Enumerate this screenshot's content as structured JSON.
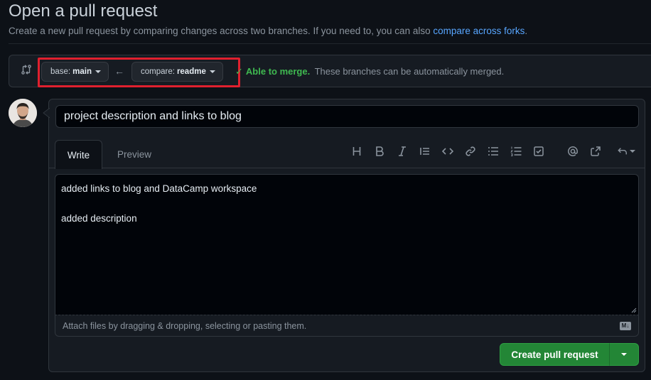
{
  "header": {
    "title": "Open a pull request",
    "subtitle": "Create a new pull request by comparing changes across two branches. If you need to, you can also ",
    "subtitle_link": "compare across forks",
    "subtitle_end": "."
  },
  "compare": {
    "base_label": "base:",
    "base_value": "main",
    "compare_label": "compare:",
    "compare_value": "readme",
    "merge_ok": "Able to merge.",
    "merge_text": "These branches can be automatically merged.",
    "highlight_color": "#e0202e"
  },
  "form": {
    "title_value": "project description and links to blog",
    "tabs": [
      {
        "label": "Write",
        "active": true
      },
      {
        "label": "Preview",
        "active": false
      }
    ],
    "toolbar_icons": [
      "heading-icon",
      "bold-icon",
      "italic-icon",
      "quote-icon",
      "code-icon",
      "link-icon",
      "bulleted-list-icon",
      "numbered-list-icon",
      "task-list-icon",
      "mention-icon",
      "cross-reference-icon",
      "reply-icon"
    ],
    "body_value": "added links to blog and DataCamp workspace\n\nadded description",
    "attach_text": "Attach files by dragging & dropping, selecting or pasting them.",
    "markdown_badge": "M↓",
    "submit_label": "Create pull request",
    "submit_color": "#238636"
  },
  "colors": {
    "background": "#0d1117",
    "link": "#58a6ff",
    "success": "#3fb950"
  }
}
